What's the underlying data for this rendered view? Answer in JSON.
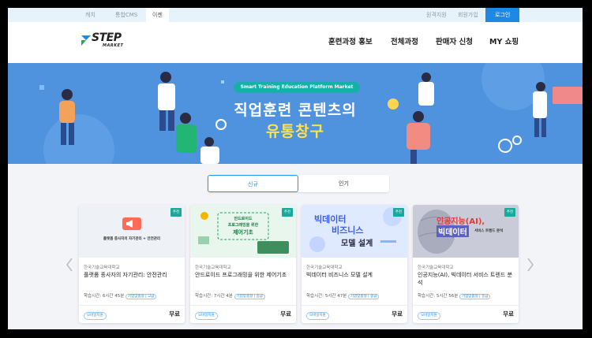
{
  "util_bar": {
    "left_tabs": [
      "캐치",
      "통합CMS",
      "이젠"
    ],
    "right_links": [
      "원격지원",
      "회원가입"
    ],
    "login_label": "로그인"
  },
  "header": {
    "logo_text": "STEP",
    "logo_sub": "MARKET",
    "nav": [
      "훈련과정 홍보",
      "전체과정",
      "판매자 신청",
      "MY 쇼핑"
    ]
  },
  "banner": {
    "pill": "Smart Training Education Platform Market",
    "headline_1": "직업훈련 콘텐츠의",
    "headline_2": "유통창구",
    "bg_color": "#4f93df",
    "accent_color": "#ffe14d"
  },
  "tabs": [
    "신규",
    "인기"
  ],
  "cards": [
    {
      "badge": "추천",
      "thumb_text": "플랫폼 종사자의 자기관리 + 안전관리",
      "school": "한국기술교육대학교",
      "title": "플랫폼 종사자의 자기관리: 안전관리",
      "time": "학습시간: 6시간 45분",
      "time_tag": "기업맞춤형 | 고급",
      "tag": "모바일지원",
      "price": "무료"
    },
    {
      "badge": "추천",
      "thumb_line1": "안드로이드",
      "thumb_line2": "프로그래밍을 위한",
      "thumb_line3": "제어기초",
      "school": "한국기술교육대학교",
      "title": "안드로이드 프로그래밍을 위한 제어기초",
      "time": "학습시간: 7시간 4분",
      "time_tag": "기업맞춤형 | 중급",
      "tag": "모바일지원",
      "price": "무료"
    },
    {
      "badge": "추천",
      "thumb_line1": "빅데이터",
      "thumb_line2": "비즈니스",
      "thumb_line3": "모델 설계",
      "school": "한국기술교육대학교",
      "title": "빅데이터 비즈니스 모델 설계",
      "time": "학습시간: 5시간 47분",
      "time_tag": "기업맞춤형 | 중급",
      "tag": "모바일지원",
      "price": "무료"
    },
    {
      "badge": "추천",
      "thumb_line1": "인공지능(AI),",
      "thumb_line2": "빅데이터",
      "thumb_line3": "서비스 트렌드 분석",
      "school": "한국기술교육대학교",
      "title": "인공지능(AI), 빅데이터 서비스 트렌드 분석",
      "time": "학습시간: 5시간 56분",
      "time_tag": "기업맞춤형 | 중급",
      "tag": "모바일지원",
      "price": "무료"
    }
  ],
  "carousel": {
    "prev_icon": "chevron-left-icon",
    "next_icon": "chevron-right-icon"
  }
}
